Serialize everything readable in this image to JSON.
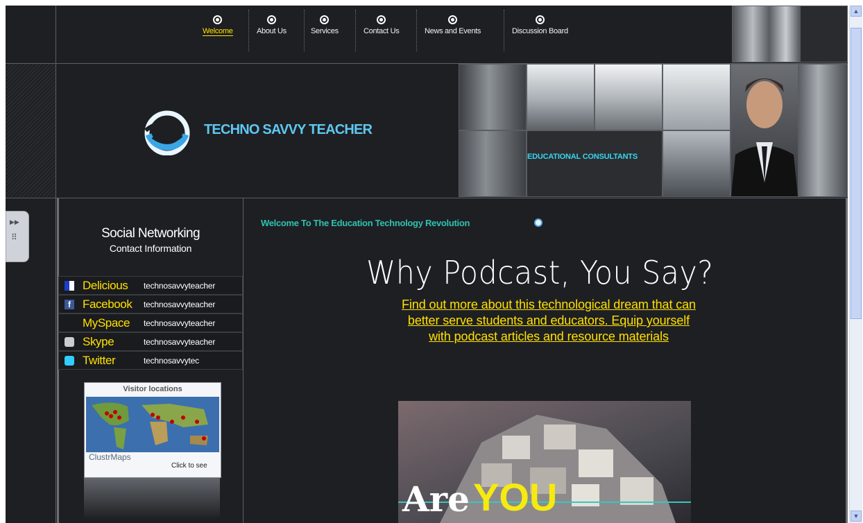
{
  "nav": {
    "items": [
      {
        "label": "Welcome",
        "active": true
      },
      {
        "label": "About Us"
      },
      {
        "label": "Services"
      },
      {
        "label": "Contact Us"
      },
      {
        "label": "News and Events"
      },
      {
        "label": "Discussion Board"
      }
    ]
  },
  "brand": {
    "name": "TECHNO SAVVY TEACHER",
    "tagline": "EDUCATIONAL CONSULTANTS"
  },
  "sidebar": {
    "title": "Social Networking",
    "subtitle": "Contact Information",
    "networks": [
      {
        "name": "Delicious",
        "handle": "technosavvyteacher",
        "icon": "delicious-icon"
      },
      {
        "name": "Facebook",
        "handle": "technosavvyteacher",
        "icon": "facebook-icon"
      },
      {
        "name": "MySpace",
        "handle": "technosavvyteacher",
        "icon": "myspace-icon"
      },
      {
        "name": "Skype",
        "handle": "technosavvyteacher",
        "icon": "skype-icon"
      },
      {
        "name": "Twitter",
        "handle": "technosavvytec",
        "icon": "twitter-icon"
      }
    ],
    "map_widget": {
      "title": "Visitor locations",
      "brand": "ClustrMaps",
      "action": "Click to see"
    }
  },
  "main": {
    "welcome": "Welcome To The Education Technology Revolution",
    "headline": "Why Podcast, You Say?",
    "promo_line1": "Find out more about this technological dream that can",
    "promo_line2": "better serve students and educators. Equip yourself",
    "promo_line3": "with podcast articles and resource materials",
    "poster_word1": "Are",
    "poster_word2": "YOU"
  },
  "colors": {
    "background": "#1e1f22",
    "accent_yellow": "#ffe100",
    "brand_blue": "#5ec8f2",
    "welcome_teal": "#2fc1b2"
  }
}
